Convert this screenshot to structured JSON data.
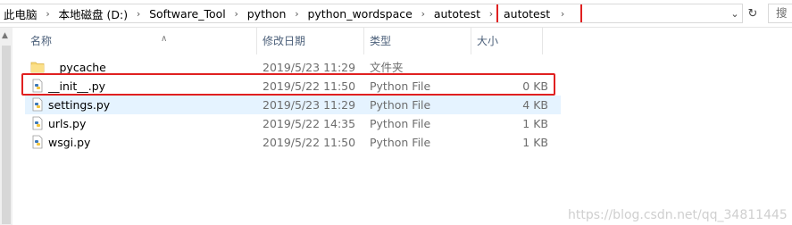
{
  "breadcrumb": {
    "items": [
      {
        "label": "此电脑"
      },
      {
        "label": "本地磁盘 (D:)"
      },
      {
        "label": "Software_Tool"
      },
      {
        "label": "python"
      },
      {
        "label": "python_wordspace"
      },
      {
        "label": "autotest"
      },
      {
        "label": "autotest"
      }
    ]
  },
  "search": {
    "placeholder": "搜"
  },
  "columns": {
    "name": "名称",
    "date": "修改日期",
    "type": "类型",
    "size": "大小"
  },
  "files": [
    {
      "name": "__pycache__",
      "date": "2019/5/23 11:29",
      "type": "文件夹",
      "size": "",
      "icon": "folder-icon"
    },
    {
      "name": "__init__.py",
      "date": "2019/5/22 11:50",
      "type": "Python File",
      "size": "0 KB",
      "icon": "python-file-icon"
    },
    {
      "name": "settings.py",
      "date": "2019/5/23 11:29",
      "type": "Python File",
      "size": "4 KB",
      "icon": "python-file-icon"
    },
    {
      "name": "urls.py",
      "date": "2019/5/22 14:35",
      "type": "Python File",
      "size": "1 KB",
      "icon": "python-file-icon"
    },
    {
      "name": "wsgi.py",
      "date": "2019/5/22 11:50",
      "type": "Python File",
      "size": "1 KB",
      "icon": "python-file-icon"
    }
  ],
  "watermark": "https://blog.csdn.net/qq_34811445",
  "colors": {
    "highlight_outline": "#e02020",
    "hover_row": "#e5f3ff",
    "header_text": "#4c607a"
  }
}
